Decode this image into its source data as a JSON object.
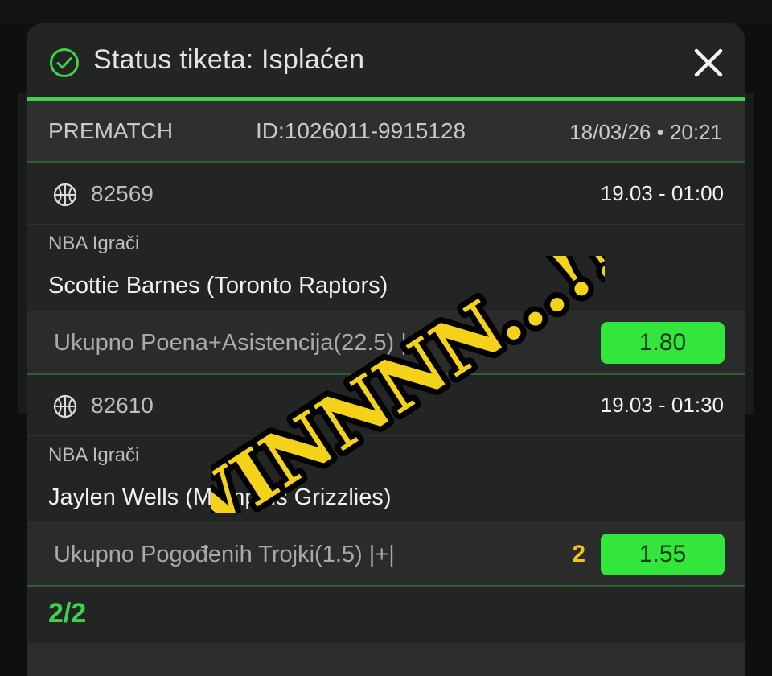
{
  "modal": {
    "status_title": "Status tiketa: Isplaćen",
    "icons": {
      "status": "check-circle-icon",
      "close": "close-icon",
      "sport": "basketball-icon"
    }
  },
  "ticket": {
    "type": "PREMATCH",
    "id": "ID:1026011-9915128",
    "datetime": "18/03/26 • 20:21"
  },
  "events": [
    {
      "code": "82569",
      "time": "19.03  -  01:00",
      "league": "NBA Igrači",
      "player": "Scottie Barnes (Toronto Raptors)",
      "market": "Ukupno Poena+Asistencija(22.5)  |+|",
      "pick": "",
      "odds": "1.80"
    },
    {
      "code": "82610",
      "time": "19.03  -  01:30",
      "league": "NBA Igrači",
      "player": "Jaylen Wells (Memphis Grizzlies)",
      "market": "Ukupno Pogođenih Trojki(1.5)  |+|",
      "pick": "2",
      "odds": "1.55"
    }
  ],
  "summary": {
    "count": "2/2"
  },
  "sticker": {
    "text": "WINNNN...!!!",
    "color": "#f4d21a",
    "outline": "#000000"
  },
  "colors": {
    "accent": "#3fd14a",
    "odds_bg": "#33e63b",
    "pick": "#f3c31a"
  }
}
